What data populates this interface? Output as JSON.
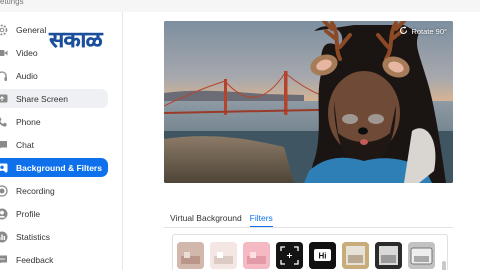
{
  "window": {
    "title": "ettings"
  },
  "logo": {
    "text": "सकाळ"
  },
  "sidebar": {
    "items": [
      {
        "label": "General",
        "icon": "gear-icon"
      },
      {
        "label": "Video",
        "icon": "video-camera-icon"
      },
      {
        "label": "Audio",
        "icon": "headphones-icon"
      },
      {
        "label": "Share Screen",
        "icon": "share-screen-icon"
      },
      {
        "label": "Phone",
        "icon": "phone-icon"
      },
      {
        "label": "Chat",
        "icon": "chat-icon"
      },
      {
        "label": "Background & Filters",
        "icon": "background-filters-icon"
      },
      {
        "label": "Recording",
        "icon": "recording-icon"
      },
      {
        "label": "Profile",
        "icon": "profile-icon"
      },
      {
        "label": "Statistics",
        "icon": "statistics-icon"
      },
      {
        "label": "Feedback",
        "icon": "feedback-icon"
      }
    ],
    "active": "Background & Filters",
    "hovered": "Share Screen"
  },
  "preview": {
    "rotate_label": "Rotate 90°"
  },
  "tabs": [
    {
      "label": "Virtual Background",
      "active": false
    },
    {
      "label": "Filters",
      "active": true
    }
  ],
  "filters": {
    "items": [
      {
        "name": "filter-warm-tone"
      },
      {
        "name": "filter-soft-light"
      },
      {
        "name": "filter-pink"
      },
      {
        "name": "filter-viewfinder"
      },
      {
        "name": "filter-hi-sticker",
        "label": "Hi"
      },
      {
        "name": "filter-gold-frame"
      },
      {
        "name": "filter-dark-frame"
      },
      {
        "name": "filter-tv-frame"
      }
    ]
  },
  "colors": {
    "accent": "#0e71eb",
    "logo": "#1b4f9c"
  }
}
